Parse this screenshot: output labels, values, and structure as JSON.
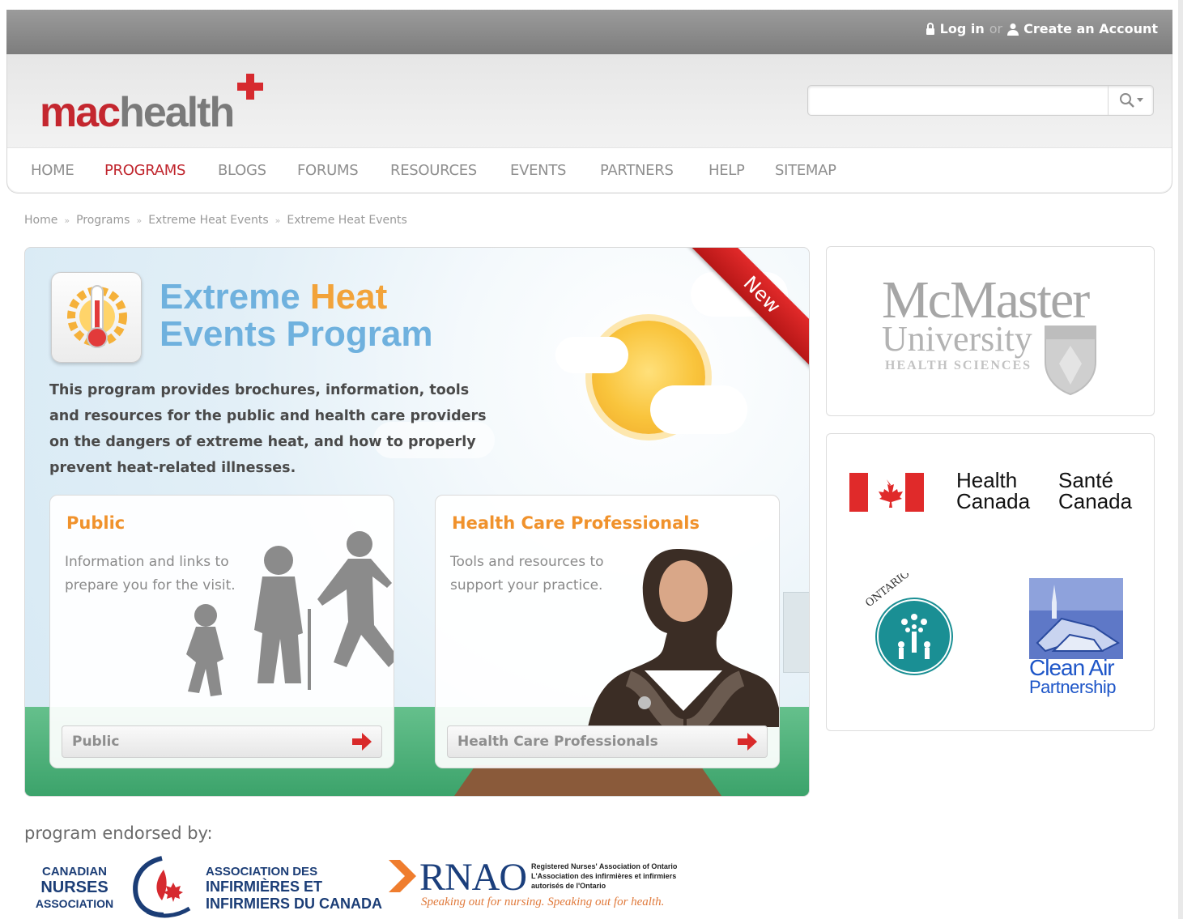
{
  "topbar": {
    "login_label": "Log in",
    "or_label": "or",
    "create_label": "Create an Account"
  },
  "logo": {
    "mac": "mac",
    "health": "health"
  },
  "search": {
    "placeholder": ""
  },
  "nav": [
    {
      "label": "HOME",
      "active": false
    },
    {
      "label": "PROGRAMS",
      "active": true
    },
    {
      "label": "BLOGS",
      "active": false
    },
    {
      "label": "FORUMS",
      "active": false
    },
    {
      "label": "RESOURCES",
      "active": false
    },
    {
      "label": "EVENTS",
      "active": false
    },
    {
      "label": "PARTNERS",
      "active": false
    },
    {
      "label": "HELP",
      "active": false
    },
    {
      "label": "SITEMAP",
      "active": false
    }
  ],
  "breadcrumb": [
    "Home",
    "Programs",
    "Extreme Heat Events",
    "Extreme Heat Events"
  ],
  "program": {
    "title_1a": "Extreme ",
    "title_1b": "Heat",
    "title_2": "Events Program",
    "ribbon": "New",
    "description": "This program provides brochures, information, tools and resources for the public and health care providers on the dangers of extreme heat, and how to properly prevent heat-related illnesses."
  },
  "cards": {
    "public": {
      "title": "Public",
      "text": "Information and links to prepare you for the visit.",
      "button": "Public"
    },
    "hcp": {
      "title": "Health Care Professionals",
      "text": "Tools and resources to support your practice.",
      "button": "Health Care Professionals"
    }
  },
  "sidebar": {
    "mcmaster": {
      "line1": "McMaster",
      "line2": "University",
      "line3": "HEALTH SCIENCES"
    },
    "health_canada": {
      "en_1": "Health",
      "en_2": "Canada",
      "fr_1": "Santé",
      "fr_2": "Canada"
    },
    "ocfp": {
      "ring_text": "ONTARIO COLLEGE OF FAMILY PHYSICIANS"
    },
    "clean_air": {
      "line1": "Clean Air",
      "line2": "Partnership"
    }
  },
  "endorsed": {
    "label": "program endorsed by:",
    "cna_en": [
      "CANADIAN",
      "NURSES",
      "ASSOCIATION"
    ],
    "cna_fr": [
      "ASSOCIATION DES",
      "INFIRMIÈRES ET",
      "INFIRMIERS DU CANADA"
    ],
    "rnao": "RNAO",
    "rnao_small": [
      "Registered Nurses' Association of Ontario",
      "L'Association des infirmières et infirmiers",
      "autorisés de l'Ontario"
    ],
    "rnao_tagline": "Speaking out for nursing. Speaking out for health."
  },
  "colors": {
    "brand_red": "#c4272f",
    "title_blue": "#6fb1de",
    "accent_orange": "#f0922c"
  }
}
